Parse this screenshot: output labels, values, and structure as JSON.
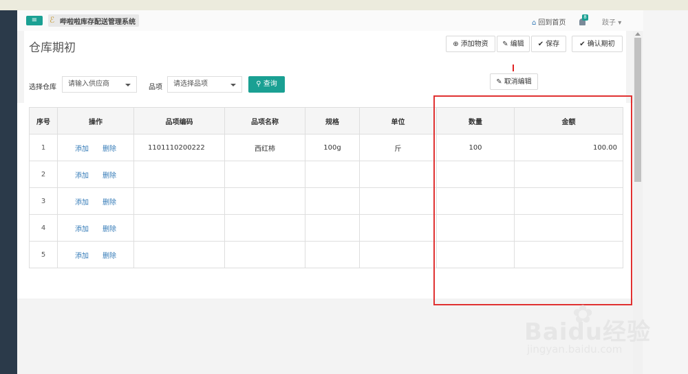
{
  "header": {
    "menu_icon": "bars-icon",
    "system_title": "哔啦啦库存配送管理系统",
    "home_label": "回到首页",
    "notification_count": "8",
    "user_name": "跂子",
    "user_caret": "▾"
  },
  "page": {
    "title": "仓库期初"
  },
  "toolbar": {
    "add_label": "添加物资",
    "edit_label": "编辑",
    "save_label": "保存",
    "confirm_label": "确认期初",
    "cancel_edit_label": "取消编辑"
  },
  "filters": {
    "warehouse_label": "选择仓库",
    "warehouse_placeholder": "请输入供应商",
    "item_label": "品项",
    "item_placeholder": "请选择品项",
    "query_label": "查询"
  },
  "table": {
    "columns": [
      "序号",
      "操作",
      "品项编码",
      "品项名称",
      "规格",
      "单位",
      "数量",
      "金额"
    ],
    "action_add": "添加",
    "action_delete": "删除",
    "rows": [
      {
        "index": "1",
        "code": "1101110200222",
        "name": "西红柿",
        "spec": "100g",
        "unit": "斤",
        "qty": "100",
        "amount": "100.00"
      },
      {
        "index": "2",
        "code": "",
        "name": "",
        "spec": "",
        "unit": "",
        "qty": "",
        "amount": ""
      },
      {
        "index": "3",
        "code": "",
        "name": "",
        "spec": "",
        "unit": "",
        "qty": "",
        "amount": ""
      },
      {
        "index": "4",
        "code": "",
        "name": "",
        "spec": "",
        "unit": "",
        "qty": "",
        "amount": ""
      },
      {
        "index": "5",
        "code": "",
        "name": "",
        "spec": "",
        "unit": "",
        "qty": "",
        "amount": ""
      }
    ]
  },
  "watermark": {
    "brand": "Baidu经验",
    "url": "jingyan.baidu.com"
  },
  "colors": {
    "accent": "#1aa093",
    "sidebar": "#2b3a4a",
    "link": "#337ab7",
    "highlight": "#e03030"
  }
}
